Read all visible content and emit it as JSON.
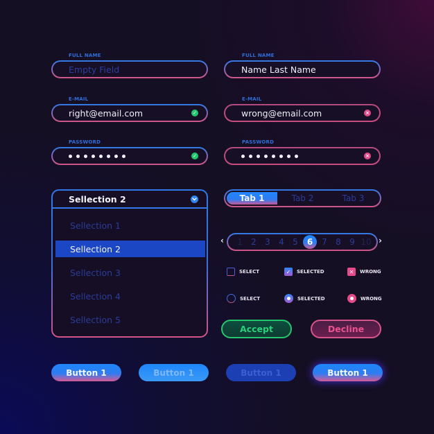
{
  "colors": {
    "background": "#150f24",
    "accent_blue": "#1f86fb",
    "accent_pink": "#d45586",
    "success": "#22c76d",
    "error": "#e54a8b"
  },
  "forms": {
    "left": {
      "full_name": {
        "label": "FULL NAME",
        "placeholder": "Empty Field",
        "value": ""
      },
      "email": {
        "label": "E-MAIL",
        "value": "right@email.com",
        "status": "valid",
        "status_icon": "check-icon"
      },
      "password": {
        "label": "PASSWORD",
        "masked_length": 8,
        "status": "valid",
        "status_icon": "check-icon"
      }
    },
    "right": {
      "full_name": {
        "label": "FULL NAME",
        "value": "Name Last Name"
      },
      "email": {
        "label": "E-MAIL",
        "value": "wrong@email.com",
        "status": "invalid",
        "status_icon": "x-icon"
      },
      "password": {
        "label": "PASSWORD",
        "masked_length": 8,
        "status": "invalid",
        "status_icon": "x-icon"
      }
    }
  },
  "dropdown": {
    "selected": "Sellection 2",
    "chevron_icon": "chevron-down-icon",
    "options": [
      "Sellection 1",
      "Sellection 2",
      "Sellection 3",
      "Sellection 4",
      "Sellection 5"
    ],
    "selected_index": 1
  },
  "tabs": {
    "items": [
      "Tab 1",
      "Tab 2",
      "Tab 3"
    ],
    "active_index": 0
  },
  "pagination": {
    "prev": "‹",
    "next": "›",
    "pages": [
      "1",
      "2",
      "3",
      "4",
      "5",
      "6",
      "7",
      "8",
      "9",
      "10"
    ],
    "current": "6"
  },
  "checkboxes": [
    {
      "label": "SELECT",
      "state": "unchecked"
    },
    {
      "label": "SELECTED",
      "state": "checked"
    },
    {
      "label": "WRONG",
      "state": "wrong"
    }
  ],
  "radios": [
    {
      "label": "SELECT",
      "state": "unchecked"
    },
    {
      "label": "SELECTED",
      "state": "checked"
    },
    {
      "label": "WRONG",
      "state": "wrong"
    }
  ],
  "actions": {
    "accept": "Accept",
    "decline": "Decline"
  },
  "buttons": [
    {
      "label": "Button 1",
      "state": "default"
    },
    {
      "label": "Button 1",
      "state": "hover"
    },
    {
      "label": "Button 1",
      "state": "disabled"
    },
    {
      "label": "Button 1",
      "state": "focused"
    }
  ]
}
